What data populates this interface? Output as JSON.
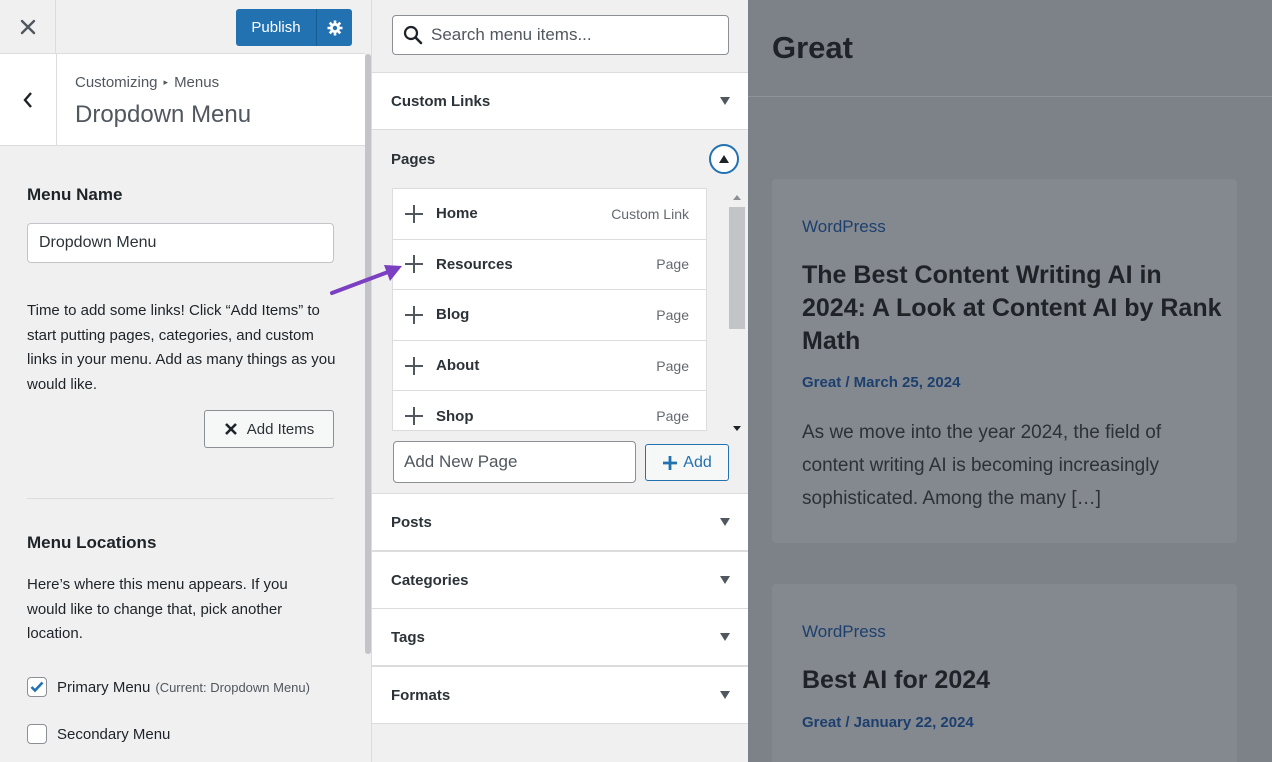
{
  "left": {
    "publish_label": "Publish",
    "breadcrumb_root": "Customizing",
    "breadcrumb_current": "Menus",
    "panel_title": "Dropdown Menu",
    "menu_name_label": "Menu Name",
    "menu_name_value": "Dropdown Menu",
    "help_text": "Time to add some links! Click “Add Items” to start putting pages, categories, and custom links in your menu. Add as many things as you would like.",
    "add_items_label": "Add Items",
    "menu_locations_label": "Menu Locations",
    "locations_help": "Here’s where this menu appears. If you would like to change that, pick another location.",
    "locations": [
      {
        "label": "Primary Menu",
        "note": "(Current: Dropdown Menu)",
        "checked": true
      },
      {
        "label": "Secondary Menu",
        "note": "",
        "checked": false
      }
    ]
  },
  "middle": {
    "search_placeholder": "Search menu items...",
    "sections": {
      "custom_links": "Custom Links",
      "pages": "Pages",
      "posts": "Posts",
      "categories": "Categories",
      "tags": "Tags",
      "formats": "Formats"
    },
    "pages": [
      {
        "title": "Home",
        "type": "Custom Link"
      },
      {
        "title": "Resources",
        "type": "Page"
      },
      {
        "title": "Blog",
        "type": "Page"
      },
      {
        "title": "About",
        "type": "Page"
      },
      {
        "title": "Shop",
        "type": "Page"
      }
    ],
    "new_page_placeholder": "Add New Page",
    "add_label": "Add"
  },
  "preview": {
    "site_title": "Great",
    "posts": [
      {
        "category": "WordPress",
        "title": "The Best Content Writing AI in 2024: A Look at Content AI by Rank Math",
        "meta": "Great / March 25, 2024",
        "excerpt": "As we move into the year 2024, the field of content writing AI is becoming increasingly sophisticated. Among the many […]"
      },
      {
        "category": "WordPress",
        "title": "Best AI for 2024",
        "meta": "Great / January 22, 2024",
        "excerpt": ""
      }
    ]
  },
  "colors": {
    "accent": "#2271b1",
    "annotation_arrow": "#7b3fc2",
    "preview_overlay": "#7c8288"
  },
  "icons": {
    "close": "close-icon",
    "gear": "gear-icon",
    "back": "chevron-left-icon",
    "search": "search-icon",
    "plus": "plus-icon",
    "dismiss": "x-icon"
  }
}
